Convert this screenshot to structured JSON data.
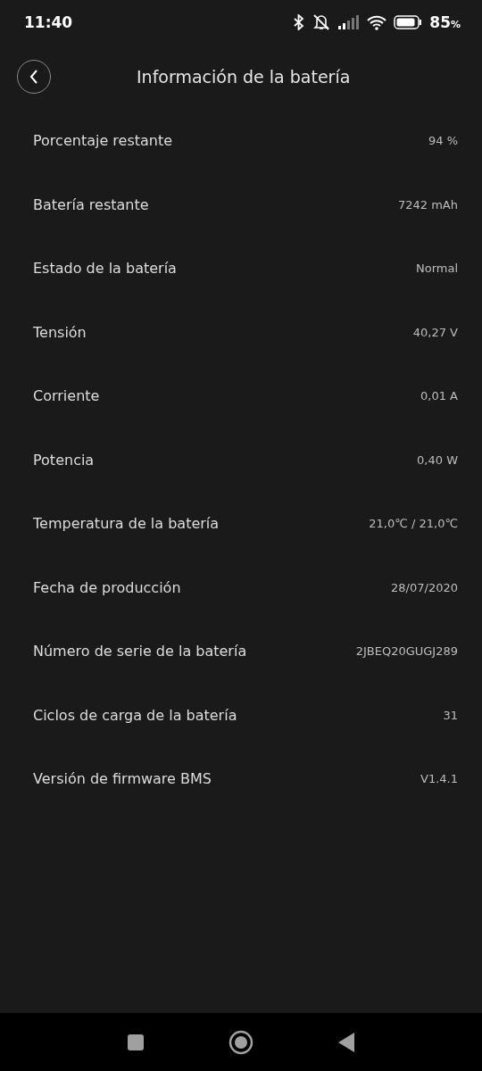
{
  "status_bar": {
    "time": "11:40",
    "battery_percent": "85",
    "percent_sign": "%"
  },
  "header": {
    "title": "Información de la batería"
  },
  "rows": [
    {
      "label": "Porcentaje restante",
      "value": "94 %"
    },
    {
      "label": "Batería restante",
      "value": "7242 mAh"
    },
    {
      "label": "Estado de la batería",
      "value": "Normal"
    },
    {
      "label": "Tensión",
      "value": "40,27 V"
    },
    {
      "label": "Corriente",
      "value": "0,01 A"
    },
    {
      "label": "Potencia",
      "value": "0,40 W"
    },
    {
      "label": "Temperatura de la batería",
      "value": "21,0℃ / 21,0℃"
    },
    {
      "label": "Fecha de producción",
      "value": "28/07/2020"
    },
    {
      "label": "Número de serie de la batería",
      "value": "2JBEQ20GUGJ289"
    },
    {
      "label": "Ciclos de carga de la batería",
      "value": "31"
    },
    {
      "label": "Versión de firmware BMS",
      "value": "V1.4.1"
    }
  ]
}
